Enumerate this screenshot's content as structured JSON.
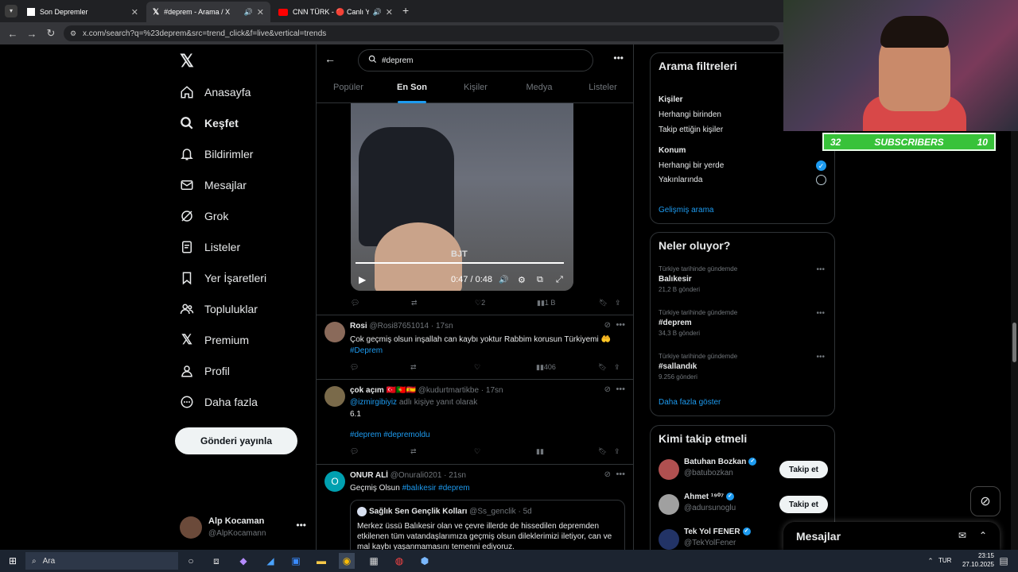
{
  "browser": {
    "tabs": [
      {
        "title": "Son Depremler",
        "active": false
      },
      {
        "title": "#deprem - Arama / X",
        "active": true
      },
      {
        "title": "CNN TÜRK - 🔴 Canlı Yayın",
        "active": false
      }
    ],
    "new_tab": "+",
    "url": "x.com/search?q=%23deprem&src=trend_click&f=live&vertical=trends"
  },
  "left_nav": {
    "items": [
      {
        "label": "Anasayfa",
        "icon": "home-icon"
      },
      {
        "label": "Keşfet",
        "icon": "search-icon",
        "active": true
      },
      {
        "label": "Bildirimler",
        "icon": "bell-icon"
      },
      {
        "label": "Mesajlar",
        "icon": "envelope-icon"
      },
      {
        "label": "Grok",
        "icon": "grok-icon"
      },
      {
        "label": "Listeler",
        "icon": "list-icon"
      },
      {
        "label": "Yer İşaretleri",
        "icon": "bookmark-icon"
      },
      {
        "label": "Topluluklar",
        "icon": "people-icon"
      },
      {
        "label": "Premium",
        "icon": "x-logo-icon"
      },
      {
        "label": "Profil",
        "icon": "user-icon"
      },
      {
        "label": "Daha fazla",
        "icon": "more-circle-icon"
      }
    ],
    "post_button": "Gönderi yayınla",
    "account": {
      "name": "Alp Kocaman",
      "handle": "@AlpKocamann"
    }
  },
  "search": {
    "query": "#deprem",
    "tabs": [
      "Popüler",
      "En Son",
      "Kişiler",
      "Medya",
      "Listeler"
    ],
    "active_tab": "En Son"
  },
  "video_post": {
    "time": "0:47 / 0:48",
    "watermark": "BJT",
    "actions": {
      "replies": "",
      "reposts": "",
      "likes": "2",
      "views": "1 B"
    }
  },
  "tweets": [
    {
      "name": "Rosi",
      "handle": "@Rosi87651014",
      "time": "17sn",
      "text": "Çok geçmiş olsun inşallah can kaybı yoktur Rabbim korusun Türkiyemi 🤲",
      "hashtags": "#Deprem",
      "views": "406"
    },
    {
      "name": "çok açım 🇹🇷🇵🇹🇪🇸",
      "handle": "@kudurtmartikbe",
      "time": "17sn",
      "reply_to_user": "@izmirgibiyiz",
      "reply_to_suffix": "adlı kişiye yanıt olarak",
      "text": "6.1",
      "hashtags": "#deprem #depremoldu"
    },
    {
      "name": "ONUR ALİ",
      "handle": "@Onurali0201",
      "time": "21sn",
      "text": "Geçmiş Olsun",
      "hashtags": "#balıkesir #deprem",
      "avatar_letter": "O",
      "quote": {
        "name": "Sağlık Sen Gençlik Kolları",
        "handle": "@Ss_genclik",
        "time": "5d",
        "text": "Merkez üssü Balıkesir olan ve çevre illerde de hissedilen depremden etkilenen tüm vatandaşlarımıza geçmiş olsun dileklerimizi iletiyor, can ve mal kaybı yaşanmamasını temenni ediyoruz."
      }
    }
  ],
  "filters": {
    "title": "Arama filtreleri",
    "people_label": "Kişiler",
    "people_opts": [
      "Herhangi birinden",
      "Takip ettiğin kişiler"
    ],
    "location_label": "Konum",
    "location_opts": [
      "Herhangi bir yerde",
      "Yakınlarında"
    ],
    "advanced": "Gelişmiş arama"
  },
  "trends": {
    "title": "Neler oluyor?",
    "items": [
      {
        "context": "Türkiye tarihinde gündemde",
        "name": "Balıkesir",
        "count": "21,2 B gönderi"
      },
      {
        "context": "Türkiye tarihinde gündemde",
        "name": "#deprem",
        "count": "34,3 B gönderi"
      },
      {
        "context": "Türkiye tarihinde gündemde",
        "name": "#sallandık",
        "count": "9.256 gönderi"
      }
    ],
    "more": "Daha fazla göster"
  },
  "who_to_follow": {
    "title": "Kimi takip etmeli",
    "items": [
      {
        "name": "Batuhan Bozkan",
        "handle": "@batubozkan",
        "button": "Takip et"
      },
      {
        "name": "Ahmet ¹⁹⁰⁷",
        "handle": "@adursunoglu",
        "button": "Takip et"
      },
      {
        "name": "Tek Yol FENER",
        "handle": "@TekYolFener",
        "button": ""
      }
    ]
  },
  "messages_drawer": {
    "title": "Mesajlar"
  },
  "stream_overlay": {
    "left_count": "32",
    "label": "SUBSCRIBERS",
    "right_count": "10"
  },
  "taskbar": {
    "search_placeholder": "Ara",
    "lang": "TUR",
    "time": "23:15",
    "date": "27.10.2025"
  },
  "colors": {
    "accent": "#1d9bf0",
    "bg": "#000000",
    "sub_green": "#38c23a"
  }
}
